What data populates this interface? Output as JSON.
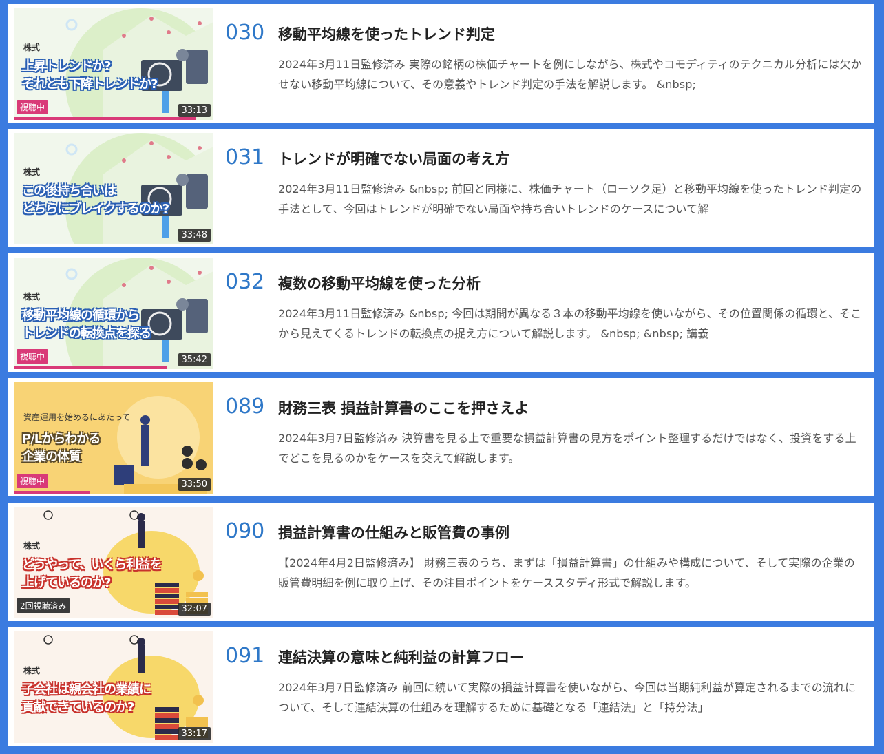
{
  "colors": {
    "accent": "#3b7be0",
    "number": "#2f78c8",
    "watching_badge": "#d93a78",
    "watched_badge": "#3b3b3b"
  },
  "lectures": [
    {
      "number": "030",
      "title": "移動平均線を使ったトレンド判定",
      "description": "2024年3月11日監修済み 実際の銘柄の株価チャートを例にしながら、株式やコモディティのテクニカル分析には欠かせない移動平均線について、その意義やトレンド判定の手法を解説します。 &nbsp;",
      "thumbnail": {
        "category": "株式",
        "lines": [
          "上昇トレンドか?",
          "それとも下降トレンドか?"
        ],
        "duration": "33:13",
        "badge": "視聴中",
        "progress": 0.91,
        "theme": "green"
      }
    },
    {
      "number": "031",
      "title": "トレンドが明確でない局面の考え方",
      "description": "2024年3月11日監修済み &nbsp; 前回と同様に、株価チャート（ローソク足）と移動平均線を使ったトレンド判定の手法として、今回はトレンドが明確でない局面や持ち合いトレンドのケースについて解",
      "thumbnail": {
        "category": "株式",
        "lines": [
          "この後持ち合いは",
          "どちらにブレイクするのか?"
        ],
        "duration": "33:48",
        "badge": "",
        "progress": 0,
        "theme": "green"
      }
    },
    {
      "number": "032",
      "title": "複数の移動平均線を使った分析",
      "description": "2024年3月11日監修済み &nbsp; 今回は期間が異なる３本の移動平均線を使いながら、その位置関係の循環と、そこから見えてくるトレンドの転換点の捉え方について解説します。 &nbsp; &nbsp; 講義",
      "thumbnail": {
        "category": "株式",
        "lines": [
          "移動平均線の循環から",
          "トレンドの転換点を探る"
        ],
        "duration": "35:42",
        "badge": "視聴中",
        "progress": 0.77,
        "theme": "green"
      }
    },
    {
      "number": "089",
      "title": "財務三表 損益計算書のここを押さえよ",
      "description": "2024年3月7日監修済み 決算書を見る上で重要な損益計算書の見方をポイント整理するだけではなく、投資をする上でどこを見るのかをケースを交えて解説します。",
      "thumbnail": {
        "category": "資産運用を始めるにあたって",
        "lines": [
          "P/Lからわかる",
          "企業の体質"
        ],
        "duration": "33:50",
        "badge": "視聴中",
        "progress": 0.38,
        "theme": "yellow"
      }
    },
    {
      "number": "090",
      "title": "損益計算書の仕組みと販管費の事例",
      "description": "【2024年4月2日監修済み】 財務三表のうち、まずは「損益計算書」の仕組みや構成について、そして実際の企業の販管費明細を例に取り上げ、その注目ポイントをケーススタディ形式で解説します。",
      "thumbnail": {
        "category": "株式",
        "lines": [
          "どうやって、いくら利益を",
          "上げているのか?"
        ],
        "duration": "32:07",
        "badge": "2回視聴済み",
        "progress": 0,
        "theme": "coins"
      }
    },
    {
      "number": "091",
      "title": "連結決算の意味と純利益の計算フロー",
      "description": "2024年3月7日監修済み 前回に続いて実際の損益計算書を使いながら、今回は当期純利益が算定されるまでの流れについて、そして連結決算の仕組みを理解するために基礎となる「連結法」と「持分法」",
      "thumbnail": {
        "category": "株式",
        "lines": [
          "子会社は親会社の業績に",
          "貢献できているのか?"
        ],
        "duration": "33:17",
        "badge": "",
        "progress": 0,
        "theme": "coins"
      }
    }
  ]
}
